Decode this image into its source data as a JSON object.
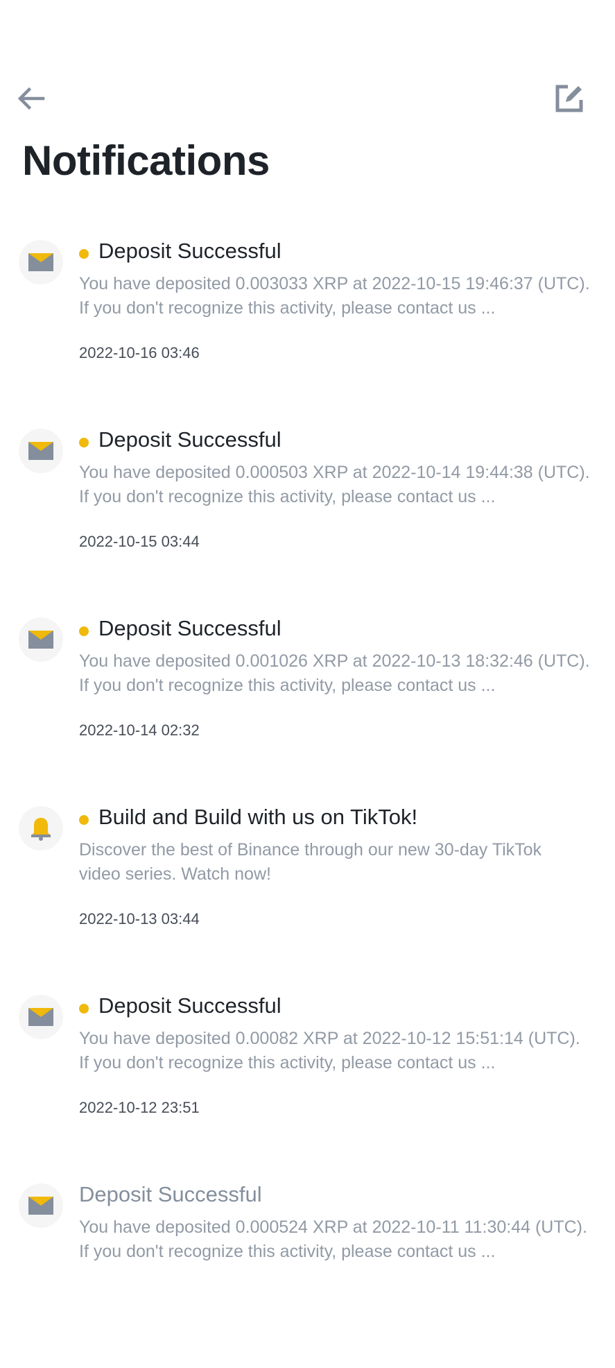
{
  "header": {
    "back_icon": "arrow-left-icon",
    "edit_icon": "edit-square-icon",
    "title": "Notifications"
  },
  "colors": {
    "accent": "#f0b90b",
    "icon_gray": "#848e9c",
    "title_text": "#1e2329",
    "body_text": "#929aa5",
    "date_text": "#474d57"
  },
  "notifications": [
    {
      "icon": "envelope-icon",
      "unread": true,
      "title": "Deposit Successful",
      "line1": "You have deposited 0.003033 XRP at 2022-10-15 19:46:37 (UTC).",
      "line2": "If you don't recognize this activity, please contact us ...",
      "date": "2022-10-16 03:46"
    },
    {
      "icon": "envelope-icon",
      "unread": true,
      "title": "Deposit Successful",
      "line1": "You have deposited 0.000503 XRP at 2022-10-14 19:44:38 (UTC).",
      "line2": "If you don't recognize this activity, please contact us ...",
      "date": "2022-10-15 03:44"
    },
    {
      "icon": "envelope-icon",
      "unread": true,
      "title": "Deposit Successful",
      "line1": "You have deposited 0.001026 XRP at 2022-10-13 18:32:46 (UTC).",
      "line2": "If you don't recognize this activity, please contact us ...",
      "date": "2022-10-14 02:32"
    },
    {
      "icon": "bell-icon",
      "unread": true,
      "title": "Build and Build with us on TikTok!",
      "line1": "Discover the best of Binance through our new 30-day TikTok",
      "line2": "video series. Watch now!",
      "date": "2022-10-13 03:44"
    },
    {
      "icon": "envelope-icon",
      "unread": true,
      "title": "Deposit Successful",
      "line1": "You have deposited 0.00082 XRP at 2022-10-12 15:51:14 (UTC).",
      "line2": "If you don't recognize this activity, please contact us ...",
      "date": "2022-10-12 23:51"
    },
    {
      "icon": "envelope-icon",
      "unread": false,
      "title": "Deposit Successful",
      "line1": "You have deposited 0.000524 XRP at 2022-10-11 11:30:44 (UTC).",
      "line2": "If you don't recognize this activity, please contact us ...",
      "date": ""
    }
  ]
}
